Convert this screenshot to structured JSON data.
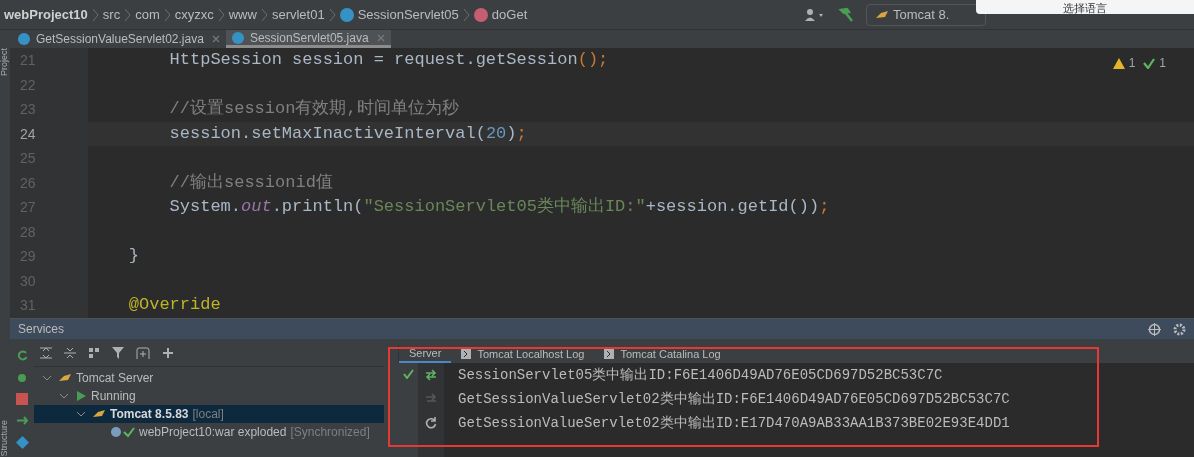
{
  "breadcrumbs": [
    {
      "text": "webProject10",
      "kind": "project"
    },
    {
      "text": "src",
      "kind": "folder"
    },
    {
      "text": "com",
      "kind": "folder"
    },
    {
      "text": "cxyzxc",
      "kind": "folder"
    },
    {
      "text": "www",
      "kind": "folder"
    },
    {
      "text": "servlet01",
      "kind": "folder"
    },
    {
      "text": "SessionServlet05",
      "kind": "class"
    },
    {
      "text": "doGet",
      "kind": "method"
    }
  ],
  "run_config": {
    "label": "Tomcat 8."
  },
  "language_popup": {
    "text": "选择语言"
  },
  "side_strips": {
    "top": "Project",
    "bottom": "Structure"
  },
  "tabs": [
    {
      "label": "GetSessionValueServlet02.java",
      "selected": false
    },
    {
      "label": "SessionServlet05.java",
      "selected": true
    }
  ],
  "inspections": {
    "warnings": "1",
    "ok": "1"
  },
  "code_lines": [
    {
      "number": "21",
      "current": false,
      "segments": [
        {
          "text": "        HttpSession session = request.getSession",
          "kind": "plain"
        },
        {
          "text": "();",
          "kind": "punct"
        }
      ]
    },
    {
      "number": "22",
      "current": false
    },
    {
      "number": "23",
      "current": false,
      "segments": [
        {
          "text": "        //设置session有效期,时间单位为秒",
          "kind": "comment"
        }
      ]
    },
    {
      "number": "24",
      "current": true,
      "segments": [
        {
          "text": "        session.setMaxInactiveInterval(",
          "kind": "plain"
        },
        {
          "text": "20",
          "kind": "number"
        },
        {
          "text": ")",
          "kind": "plain"
        },
        {
          "text": ";",
          "kind": "punct"
        }
      ]
    },
    {
      "number": "25",
      "current": false
    },
    {
      "number": "26",
      "current": false,
      "segments": [
        {
          "text": "        //输出sessionid值",
          "kind": "comment"
        }
      ]
    },
    {
      "number": "27",
      "current": false,
      "segments": [
        {
          "text": "        System.",
          "kind": "plain"
        },
        {
          "text": "out",
          "kind": "static"
        },
        {
          "text": ".println(",
          "kind": "plain"
        },
        {
          "text": "\"SessionServlet05类中输出ID:\"",
          "kind": "string"
        },
        {
          "text": "+session.getId())",
          "kind": "plain"
        },
        {
          "text": ";",
          "kind": "punct"
        }
      ]
    },
    {
      "number": "28",
      "current": false
    },
    {
      "number": "29",
      "current": false,
      "segments": [
        {
          "text": "    }",
          "kind": "plain"
        }
      ]
    },
    {
      "number": "30",
      "current": false
    },
    {
      "number": "31",
      "current": false,
      "segments": [
        {
          "text": "    @Override",
          "kind": "annotation"
        }
      ]
    }
  ],
  "services": {
    "title": "Services",
    "tree": [
      {
        "label": "Tomcat Server",
        "kind": "server",
        "bold": false,
        "selected": false,
        "expanded": true,
        "children": [
          {
            "label": "Running",
            "kind": "running",
            "bold": false,
            "selected": false,
            "expanded": true,
            "children": [
              {
                "label": "Tomcat 8.5.83",
                "kind": "tomcat",
                "bold": true,
                "note": "[local]",
                "selected": true,
                "expanded": true,
                "children": [
                  {
                    "label": "webProject10:war exploded",
                    "kind": "artifact",
                    "bold": false,
                    "note": "[Synchronized]",
                    "selected": false,
                    "expanded": false
                  }
                ]
              }
            ]
          }
        ]
      }
    ],
    "console_tabs": [
      {
        "label": "Server",
        "selected": true,
        "kind": "plain"
      },
      {
        "label": "Tomcat Localhost Log",
        "selected": false,
        "kind": "log"
      },
      {
        "label": "Tomcat Catalina Log",
        "selected": false,
        "kind": "log"
      }
    ],
    "console_lines": [
      "SessionServlet05类中输出ID:F6E1406D49AD76E05CD697D52BC53C7C",
      "GetSessionValueServlet02类中输出ID:F6E1406D49AD76E05CD697D52BC53C7C",
      "GetSessionValueServlet02类中输出ID:E17D470A9AB33AA1B373BE02E93E4DD1"
    ],
    "highlight": true
  }
}
